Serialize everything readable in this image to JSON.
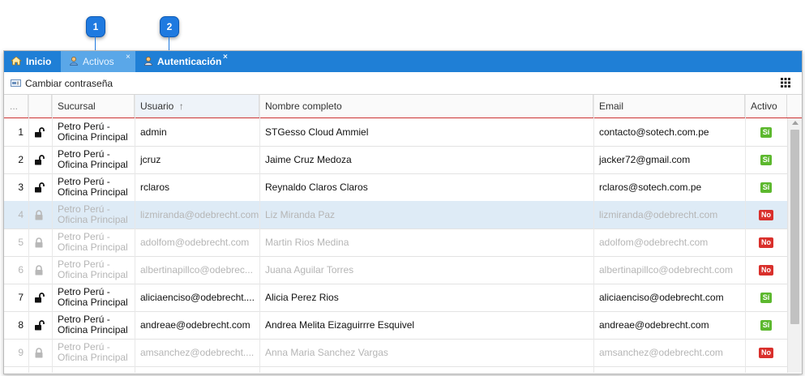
{
  "callouts": [
    "1",
    "2"
  ],
  "tabs": [
    {
      "label": "Inicio",
      "icon": "home-icon"
    },
    {
      "label": "Activos",
      "icon": "user-icon",
      "close": "×"
    },
    {
      "label": "Autenticación",
      "icon": "user-lock-icon",
      "close": "×"
    }
  ],
  "toolbar": {
    "change_password": "Cambiar contraseña"
  },
  "columns": {
    "index": "...",
    "lock": "",
    "sucursal": "Sucursal",
    "usuario": "Usuario",
    "usuario_sort": "↑",
    "nombre": "Nombre completo",
    "email": "Email",
    "activo": "Activo"
  },
  "rows": [
    {
      "n": "1",
      "sucursal": "Petro Perú - Oficina Principal",
      "usuario": "admin",
      "nombre": "STGesso Cloud Ammiel",
      "email": "contacto@sotech.com.pe",
      "activo": "Sí"
    },
    {
      "n": "2",
      "sucursal": "Petro Perú - Oficina Principal",
      "usuario": "jcruz",
      "nombre": "Jaime Cruz Medoza",
      "email": "jacker72@gmail.com",
      "activo": "Sí"
    },
    {
      "n": "3",
      "sucursal": "Petro Perú - Oficina Principal",
      "usuario": "rclaros",
      "nombre": "Reynaldo Claros Claros",
      "email": "rclaros@sotech.com.pe",
      "activo": "Sí"
    },
    {
      "n": "4",
      "sucursal": "Petro Perú - Oficina Principal",
      "usuario": "lizmiranda@odebrecht.com",
      "nombre": "Liz Miranda Paz",
      "email": "lizmiranda@odebrecht.com",
      "activo": "No"
    },
    {
      "n": "5",
      "sucursal": "Petro Perú - Oficina Principal",
      "usuario": "adolfom@odebrecht.com",
      "nombre": "Martin Rios Medina",
      "email": "adolfom@odebrecht.com",
      "activo": "No"
    },
    {
      "n": "6",
      "sucursal": "Petro Perú - Oficina Principal",
      "usuario": "albertinapillco@odebrec...",
      "nombre": "Juana Aguilar Torres",
      "email": "albertinapillco@odebrecht.com",
      "activo": "No"
    },
    {
      "n": "7",
      "sucursal": "Petro Perú - Oficina Principal",
      "usuario": "aliciaenciso@odebrecht....",
      "nombre": "Alicia Perez Rios",
      "email": "aliciaenciso@odebrecht.com",
      "activo": "Sí"
    },
    {
      "n": "8",
      "sucursal": "Petro Perú - Oficina Principal",
      "usuario": "andreae@odebrecht.com",
      "nombre": "Andrea Melita Eizaguirrre Esquivel",
      "email": "andreae@odebrecht.com",
      "activo": "Sí"
    },
    {
      "n": "9",
      "sucursal": "Petro Perú - Oficina Principal",
      "usuario": "amsanchez@odebrecht....",
      "nombre": "Anna Maria Sanchez Vargas",
      "email": "amsanchez@odebrecht.com",
      "activo": "No"
    }
  ],
  "colors": {
    "tabbar": "#1f7fd6",
    "active_tab": "#5aa7e8",
    "callout": "#1f7ae0",
    "si": "#5cb82e",
    "no": "#d9302c",
    "selected_row": "#deebf6"
  }
}
